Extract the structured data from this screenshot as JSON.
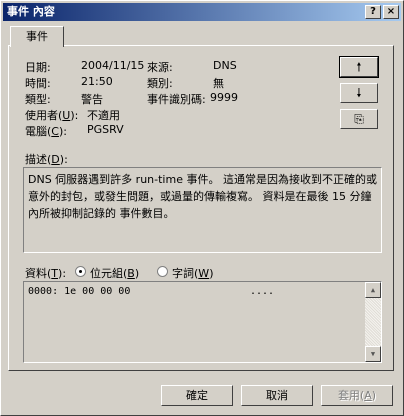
{
  "window": {
    "title": "事件 內容",
    "help": "?",
    "close": "×"
  },
  "tab": {
    "label": "事件"
  },
  "fields": {
    "date_label": "日期:",
    "date_value": "2004/11/15",
    "source_label": "來源:",
    "source_value": "DNS",
    "time_label": "時間:",
    "time_value": "21:50",
    "category_label": "類別:",
    "category_value": "無",
    "type_label": "類型:",
    "type_value": "警告",
    "eventid_label": "事件識別碼:",
    "eventid_value": "9999",
    "user_label_pre": "使用者(",
    "user_label_key": "U",
    "user_label_post": "):",
    "user_value": "不適用",
    "computer_label_pre": "電腦(",
    "computer_label_key": "C",
    "computer_label_post": "):",
    "computer_value": "PGSRV"
  },
  "nav": {
    "up_symbol": "🠕",
    "down_symbol": "🠗",
    "copy_symbol": "⎘"
  },
  "description": {
    "label_pre": "描述(",
    "label_key": "D",
    "label_post": "):",
    "text": "DNS 伺服器遇到許多 run-time 事件。 這通常是因為接收到不正確的或意外的封包，或發生問題，或過量的傳輸複寫。 資料是在最後 15 分鐘內所被抑制記錄的 事件數目。"
  },
  "data": {
    "label_pre": "資料(",
    "label_key": "T",
    "label_post": "):",
    "bytes_pre": "位元組(",
    "bytes_key": "B",
    "bytes_post": ")",
    "words_pre": "字詞(",
    "words_key": "W",
    "words_post": ")",
    "line": "0000: 1e 00 00 00",
    "ascii": "...."
  },
  "buttons": {
    "ok": "確定",
    "cancel": "取消",
    "apply_pre": "套用(",
    "apply_key": "A",
    "apply_post": ")"
  },
  "colors": {
    "titlebar_start": "#0a246a",
    "titlebar_end": "#a6caf0",
    "face": "#d4d0c8"
  }
}
